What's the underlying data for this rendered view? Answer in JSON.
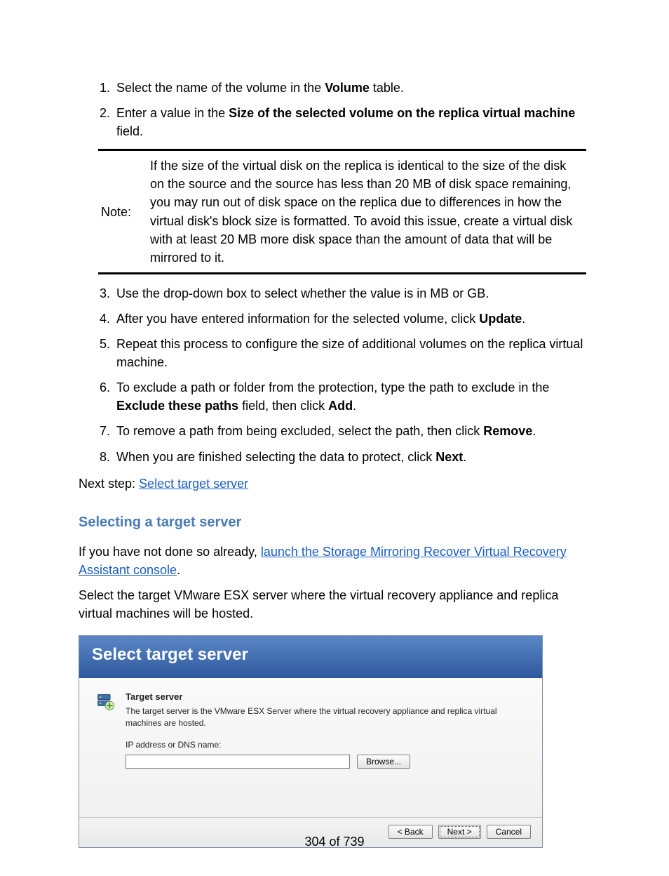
{
  "steps_first": [
    {
      "prefix": "Select the name of the volume in the ",
      "bold": "Volume",
      "suffix": " table."
    },
    {
      "prefix": "Enter a value in the ",
      "bold": "Size of the selected volume on the replica virtual machine",
      "suffix": " field."
    }
  ],
  "note": {
    "label": "Note:",
    "text": "If the size of the virtual disk on the replica is identical to the size of the disk on the source and the source has less than 20 MB of disk space remaining, you may run out of disk space on the replica due to differences in how the virtual disk's block size is formatted. To avoid this issue, create a virtual disk with at least 20 MB more disk space than the amount of data that will be mirrored to it."
  },
  "steps_second": [
    {
      "text": "Use the drop-down box to select whether the value is in MB or GB."
    },
    {
      "prefix": "After you have entered information for the selected volume, click ",
      "bold": "Update",
      "suffix": "."
    },
    {
      "text": "Repeat this process to configure the size of additional volumes on the replica virtual machine."
    },
    {
      "prefix": "To exclude a path or folder from the protection, type the path to exclude in the ",
      "bold": "Exclude these paths",
      "mid": " field, then click ",
      "bold2": "Add",
      "suffix": "."
    },
    {
      "prefix": "To remove a path from being excluded, select the path, then click ",
      "bold": "Remove",
      "suffix": "."
    },
    {
      "prefix": "When you are finished selecting the data to protect, click ",
      "bold": "Next",
      "suffix": "."
    }
  ],
  "next_step": {
    "label": "Next step: ",
    "link": "Select target server"
  },
  "section_heading": "Selecting a target server",
  "intro_para": {
    "prefix": "If you have not done so already, ",
    "link": "launch the Storage Mirroring Recover Virtual Recovery Assistant console",
    "suffix": "."
  },
  "body_para": "Select the target VMware ESX server where the virtual recovery appliance and replica virtual machines will be hosted.",
  "wizard": {
    "header": "Select target server",
    "section_title": "Target server",
    "desc": "The target server is the VMware ESX Server where the virtual recovery appliance and replica virtual machines are hosted.",
    "input_label": "IP address or DNS name:",
    "input_value": "",
    "browse": "Browse...",
    "back": "< Back",
    "next": "Next >",
    "cancel": "Cancel"
  },
  "page_number": "304 of 739"
}
